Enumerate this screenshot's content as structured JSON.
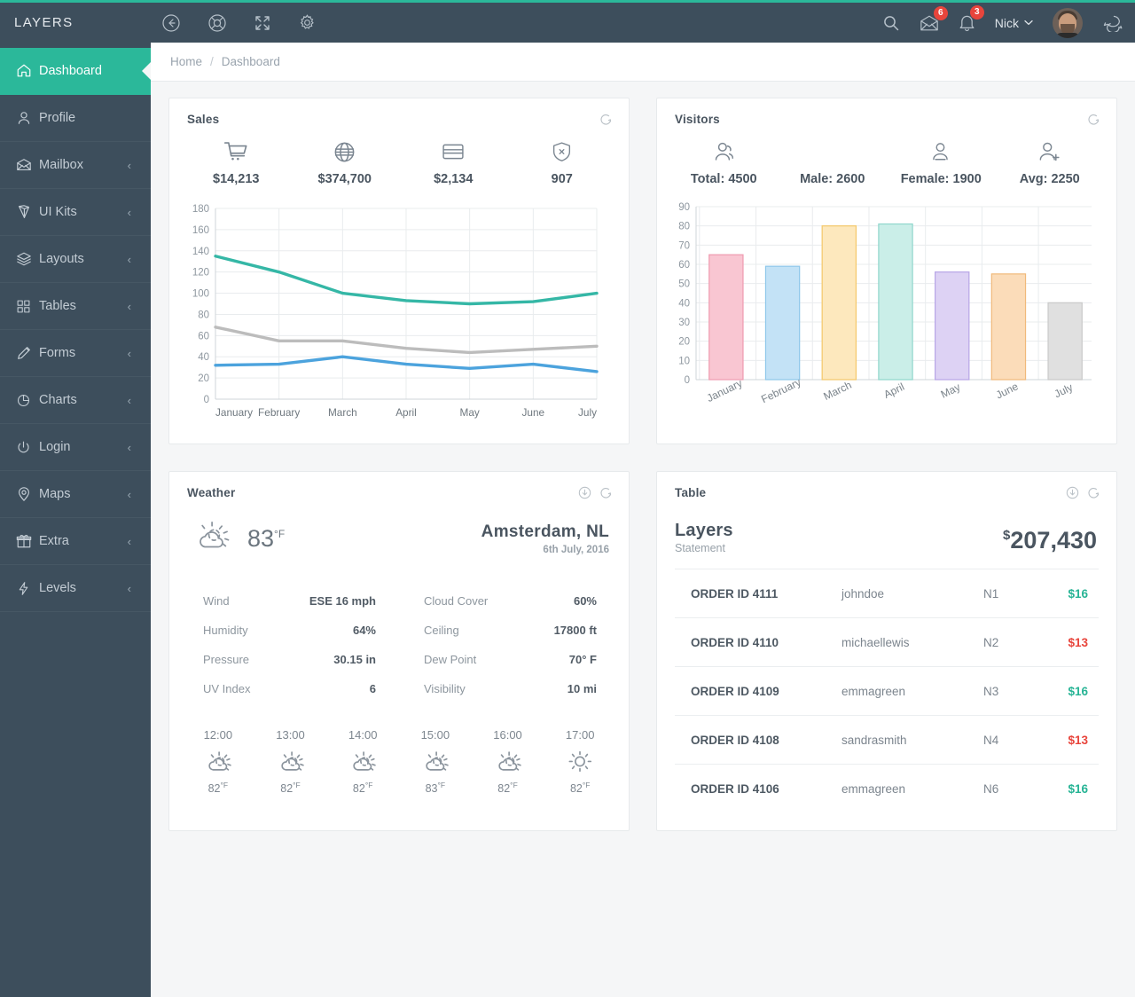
{
  "brand": "LAYERS",
  "header": {
    "left_icons": [
      "back-arrow-icon",
      "lifebuoy-icon",
      "fullscreen-icon",
      "gear-icon"
    ],
    "search_icon": "search-icon",
    "mail_badge": "6",
    "bell_badge": "3",
    "user_name": "Nick",
    "chat_icon": "chat-icon"
  },
  "sidebar": {
    "items": [
      {
        "label": "Dashboard",
        "icon": "home-icon",
        "active": true,
        "caret": ""
      },
      {
        "label": "Profile",
        "icon": "user-icon",
        "active": false,
        "caret": ""
      },
      {
        "label": "Mailbox",
        "icon": "envelope-icon",
        "active": false,
        "caret": "‹"
      },
      {
        "label": "UI Kits",
        "icon": "diamond-icon",
        "active": false,
        "caret": "‹"
      },
      {
        "label": "Layouts",
        "icon": "layers-icon",
        "active": false,
        "caret": "‹"
      },
      {
        "label": "Tables",
        "icon": "grid-icon",
        "active": false,
        "caret": "‹"
      },
      {
        "label": "Forms",
        "icon": "pencil-icon",
        "active": false,
        "caret": "‹"
      },
      {
        "label": "Charts",
        "icon": "pie-chart-icon",
        "active": false,
        "caret": "‹"
      },
      {
        "label": "Login",
        "icon": "power-icon",
        "active": false,
        "caret": "‹"
      },
      {
        "label": "Maps",
        "icon": "map-pin-icon",
        "active": false,
        "caret": "‹"
      },
      {
        "label": "Extra",
        "icon": "gift-icon",
        "active": false,
        "caret": "‹"
      },
      {
        "label": "Levels",
        "icon": "bolt-icon",
        "active": false,
        "caret": "‹"
      }
    ]
  },
  "breadcrumb": {
    "home": "Home",
    "sep": "/",
    "current": "Dashboard"
  },
  "sales": {
    "title": "Sales",
    "stats": [
      {
        "icon": "cart-icon",
        "value": "$14,213"
      },
      {
        "icon": "globe-icon",
        "value": "$374,700"
      },
      {
        "icon": "credit-card-icon",
        "value": "$2,134"
      },
      {
        "icon": "shield-x-icon",
        "value": "907"
      }
    ]
  },
  "visitors": {
    "title": "Visitors",
    "stats": [
      {
        "icon": "users-icon",
        "value": "Total: 4500"
      },
      {
        "icon": "user-icon",
        "value": "Male: 2600"
      },
      {
        "icon": "user-female-icon",
        "value": "Female: 1900"
      },
      {
        "icon": "user-add-icon",
        "value": "Avg: 2250"
      }
    ]
  },
  "weather": {
    "title": "Weather",
    "current_temp": "83",
    "current_unit": "°F",
    "icon": "sun-cloud-icon",
    "city": "Amsterdam, NL",
    "date": "6th July, 2016",
    "left_details": [
      {
        "key": "Wind",
        "value": "ESE 16 mph"
      },
      {
        "key": "Humidity",
        "value": "64%"
      },
      {
        "key": "Pressure",
        "value": "30.15 in"
      },
      {
        "key": "UV Index",
        "value": "6"
      }
    ],
    "right_details": [
      {
        "key": "Cloud Cover",
        "value": "60%"
      },
      {
        "key": "Ceiling",
        "value": "17800 ft"
      },
      {
        "key": "Dew Point",
        "value": "70° F"
      },
      {
        "key": "Visibility",
        "value": "10 mi"
      }
    ],
    "hours": [
      {
        "time": "12:00",
        "icon": "sun-cloud-icon",
        "temp": "82",
        "unit": "°F"
      },
      {
        "time": "13:00",
        "icon": "sun-cloud-icon",
        "temp": "82",
        "unit": "°F"
      },
      {
        "time": "14:00",
        "icon": "sun-cloud-icon",
        "temp": "82",
        "unit": "°F"
      },
      {
        "time": "15:00",
        "icon": "sun-cloud-icon",
        "temp": "83",
        "unit": "°F"
      },
      {
        "time": "16:00",
        "icon": "sun-cloud-icon",
        "temp": "82",
        "unit": "°F"
      },
      {
        "time": "17:00",
        "icon": "sun-icon",
        "temp": "82",
        "unit": "°F"
      }
    ]
  },
  "table": {
    "title": "Table",
    "summary_name": "Layers",
    "summary_sub": "Statement",
    "currency": "$",
    "summary_amount": "207,430",
    "rows": [
      {
        "id": "ORDER ID 4111",
        "user": "johndoe",
        "n": "N1",
        "amount": "$16",
        "positive": true
      },
      {
        "id": "ORDER ID 4110",
        "user": "michaellewis",
        "n": "N2",
        "amount": "$13",
        "positive": false
      },
      {
        "id": "ORDER ID 4109",
        "user": "emmagreen",
        "n": "N3",
        "amount": "$16",
        "positive": true
      },
      {
        "id": "ORDER ID 4108",
        "user": "sandrasmith",
        "n": "N4",
        "amount": "$13",
        "positive": false
      },
      {
        "id": "ORDER ID 4106",
        "user": "emmagreen",
        "n": "N6",
        "amount": "$16",
        "positive": true
      }
    ]
  },
  "colors": {
    "accent": "#2bb89a",
    "sidebar": "#3d4e5c",
    "positive": "#27b495",
    "negative": "#e8453c",
    "line_teal": "#35b7a6",
    "line_gray": "#bcbcbc",
    "line_blue": "#4ca3dd"
  },
  "chart_data": [
    {
      "type": "line",
      "title": "Sales",
      "categories": [
        "January",
        "February",
        "March",
        "April",
        "May",
        "June",
        "July"
      ],
      "series": [
        {
          "name": "teal",
          "color": "#35b7a6",
          "values": [
            135,
            120,
            100,
            93,
            90,
            92,
            100
          ]
        },
        {
          "name": "gray",
          "color": "#bcbcbc",
          "values": [
            68,
            55,
            55,
            48,
            44,
            47,
            50
          ]
        },
        {
          "name": "blue",
          "color": "#4ca3dd",
          "values": [
            32,
            33,
            40,
            33,
            29,
            33,
            26
          ]
        }
      ],
      "yticks": [
        0,
        20,
        40,
        60,
        80,
        100,
        120,
        140,
        160,
        180
      ],
      "ylim": [
        0,
        180
      ],
      "xlabel": "",
      "ylabel": "",
      "grid": true,
      "legend": "none"
    },
    {
      "type": "bar",
      "title": "Visitors",
      "categories": [
        "January",
        "February",
        "March",
        "April",
        "May",
        "June",
        "July"
      ],
      "values": [
        65,
        59,
        80,
        81,
        56,
        55,
        40
      ],
      "bar_colors": [
        "#f9c6d2",
        "#c3e2f6",
        "#fde8bd",
        "#caeee8",
        "#ddd2f4",
        "#fbdcb9",
        "#e0e0e0"
      ],
      "bar_borders": [
        "#ef9bb0",
        "#8ec7ea",
        "#f4c86a",
        "#8fd6cc",
        "#b7a5e6",
        "#f0b97a",
        "#c9c9c9"
      ],
      "yticks": [
        0,
        10,
        20,
        30,
        40,
        50,
        60,
        70,
        80,
        90
      ],
      "ylim": [
        0,
        90
      ],
      "xlabel": "",
      "ylabel": "",
      "grid": true,
      "legend": "none"
    }
  ]
}
